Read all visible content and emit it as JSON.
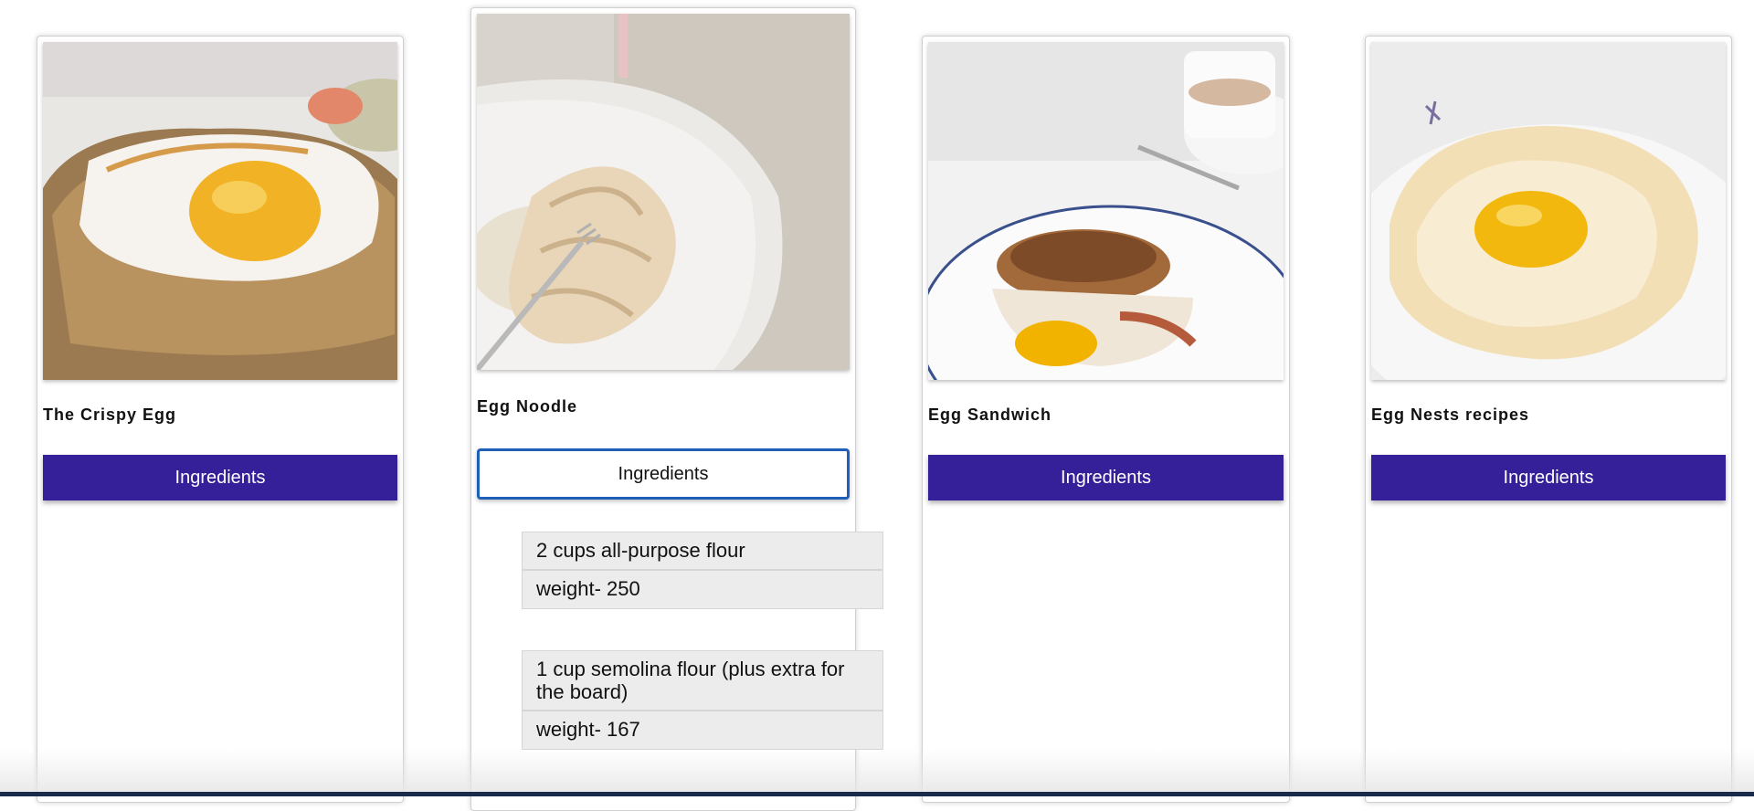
{
  "cards": [
    {
      "title": "The Crispy Egg",
      "button_label": "Ingredients",
      "image_icon": "fried-egg-on-toast"
    },
    {
      "title": "Egg Noodle",
      "button_label": "Ingredients",
      "image_icon": "noodles-on-plate"
    },
    {
      "title": "Egg Sandwich",
      "button_label": "Ingredients",
      "image_icon": "egg-muffin-sandwich"
    },
    {
      "title": "Egg Nests recipes",
      "button_label": "Ingredients",
      "image_icon": "egg-nest-cloud"
    }
  ],
  "ingredients": [
    {
      "name": "2 cups all-purpose flour",
      "weight": "weight- 250"
    },
    {
      "name": "1 cup semolina flour (plus extra for the board)",
      "weight": "weight- 167"
    }
  ],
  "colors": {
    "button_bg": "#35209a",
    "active_button_border": "#1f5fb8",
    "ingredient_bg": "#ececec"
  }
}
